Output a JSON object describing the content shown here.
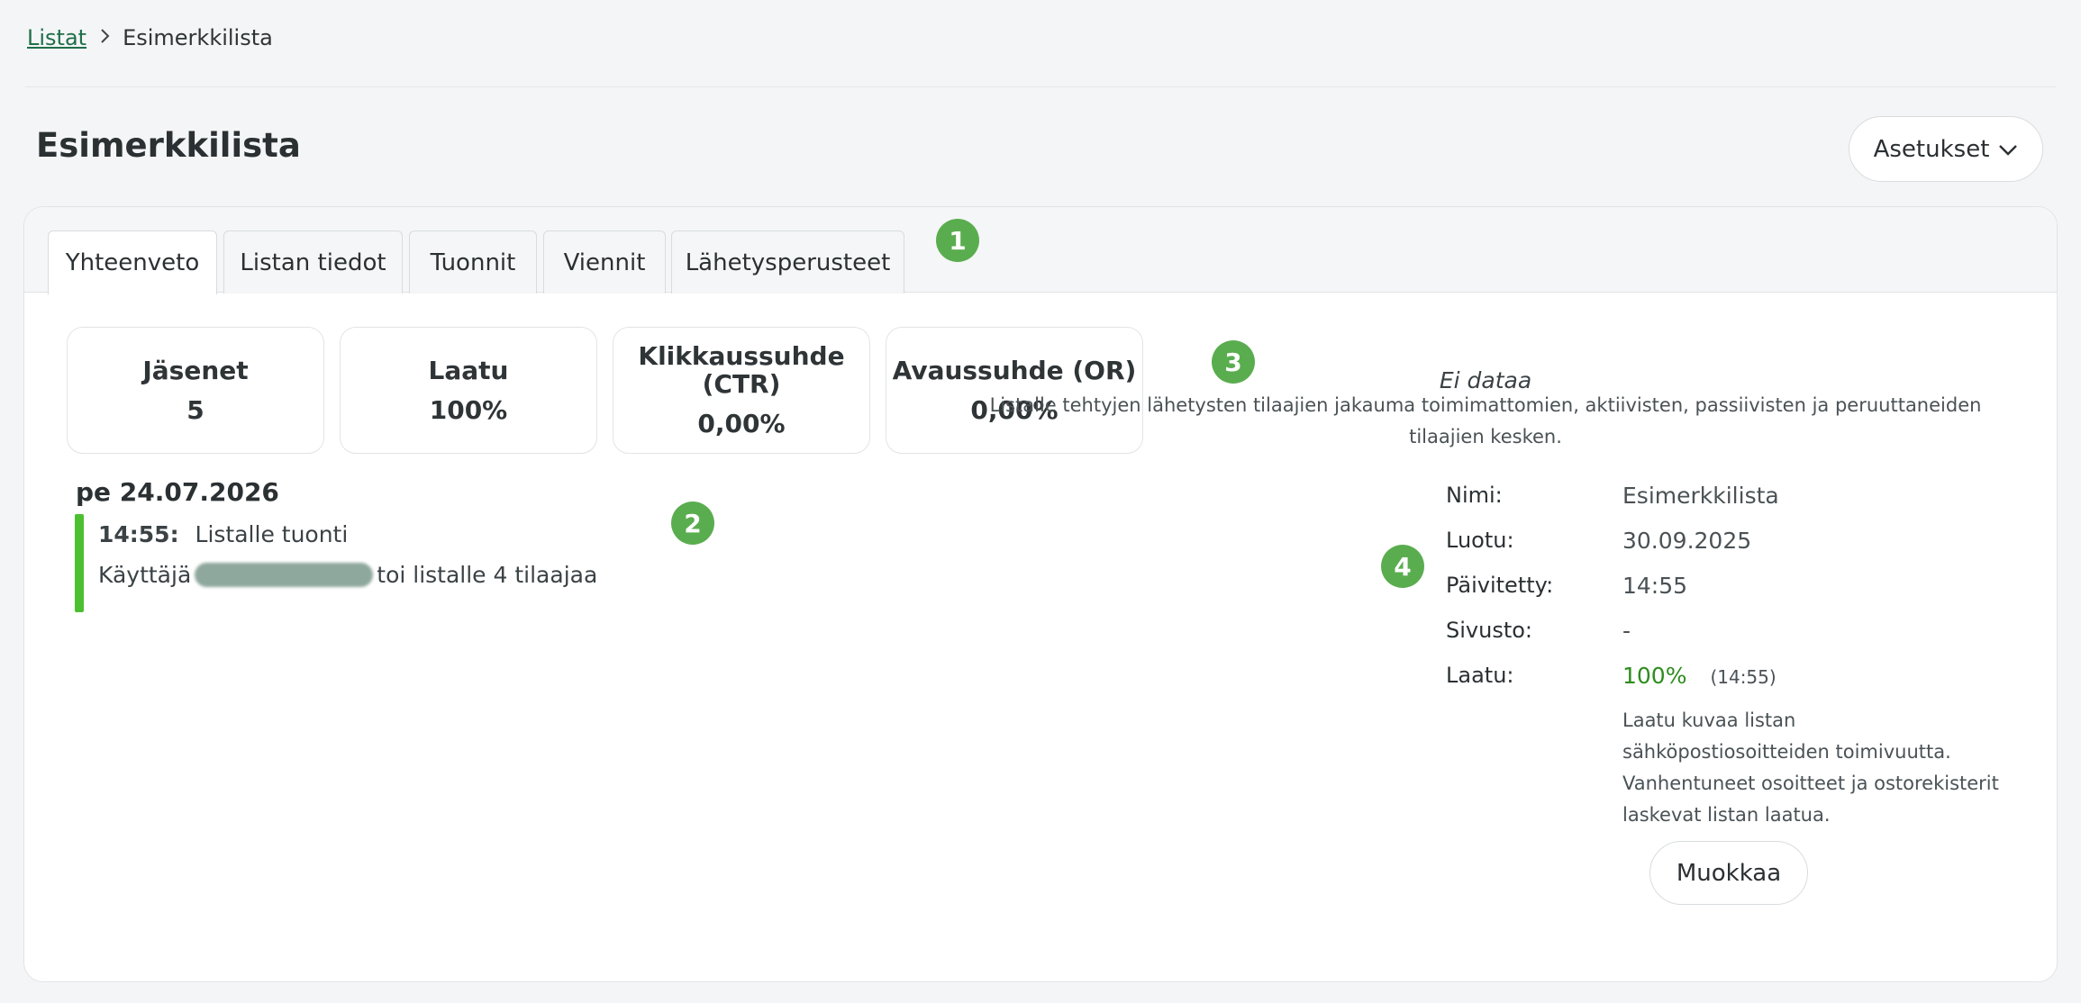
{
  "breadcrumb": {
    "parent": "Listat",
    "current": "Esimerkkilista"
  },
  "header": {
    "title": "Esimerkkilista",
    "settings_label": "Asetukset"
  },
  "tabs": [
    {
      "label": "Yhteenveto",
      "active": true
    },
    {
      "label": "Listan tiedot"
    },
    {
      "label": "Tuonnit"
    },
    {
      "label": "Viennit"
    },
    {
      "label": "Lähetysperusteet"
    }
  ],
  "badges": [
    "1",
    "2",
    "3",
    "4"
  ],
  "stats": [
    {
      "label": "Jäsenet",
      "value": "5"
    },
    {
      "label": "Laatu",
      "value": "100%"
    },
    {
      "label": "Klikkaussuhde (CTR)",
      "value": "0,00%"
    },
    {
      "label": "Avaussuhde (OR)",
      "value": "0,00%"
    }
  ],
  "timeline": {
    "date": "pe 24.07.2026",
    "time": "14:55:",
    "event": "Listalle tuonti",
    "detail_prefix": "Käyttäjä",
    "detail_suffix": "toi listalle 4 tilaajaa"
  },
  "distribution": {
    "title": "Ei dataa",
    "description": "Listalle tehtyjen lähetysten tilaajien jakauma toimimattomien, aktiivisten, passiivisten ja peruuttaneiden tilaajien kesken."
  },
  "info": {
    "name_label": "Nimi:",
    "name_value": "Esimerkkilista",
    "created_label": "Luotu:",
    "created_value": "30.09.2025",
    "updated_label": "Päivitetty:",
    "updated_value": "14:55",
    "site_label": "Sivusto:",
    "site_value": "-",
    "quality_label": "Laatu:",
    "quality_value": "100%",
    "quality_time": "(14:55)",
    "quality_description": "Laatu kuvaa listan sähköpostiosoitteiden toimivuutta. Vanhentuneet osoitteet ja ostorekisterit laskevat listan laatua."
  },
  "edit_label": "Muokkaa",
  "colors": {
    "accent_green": "#5aad4f",
    "timeline_green": "#4cc030",
    "quality_green": "#2e8c1e"
  }
}
